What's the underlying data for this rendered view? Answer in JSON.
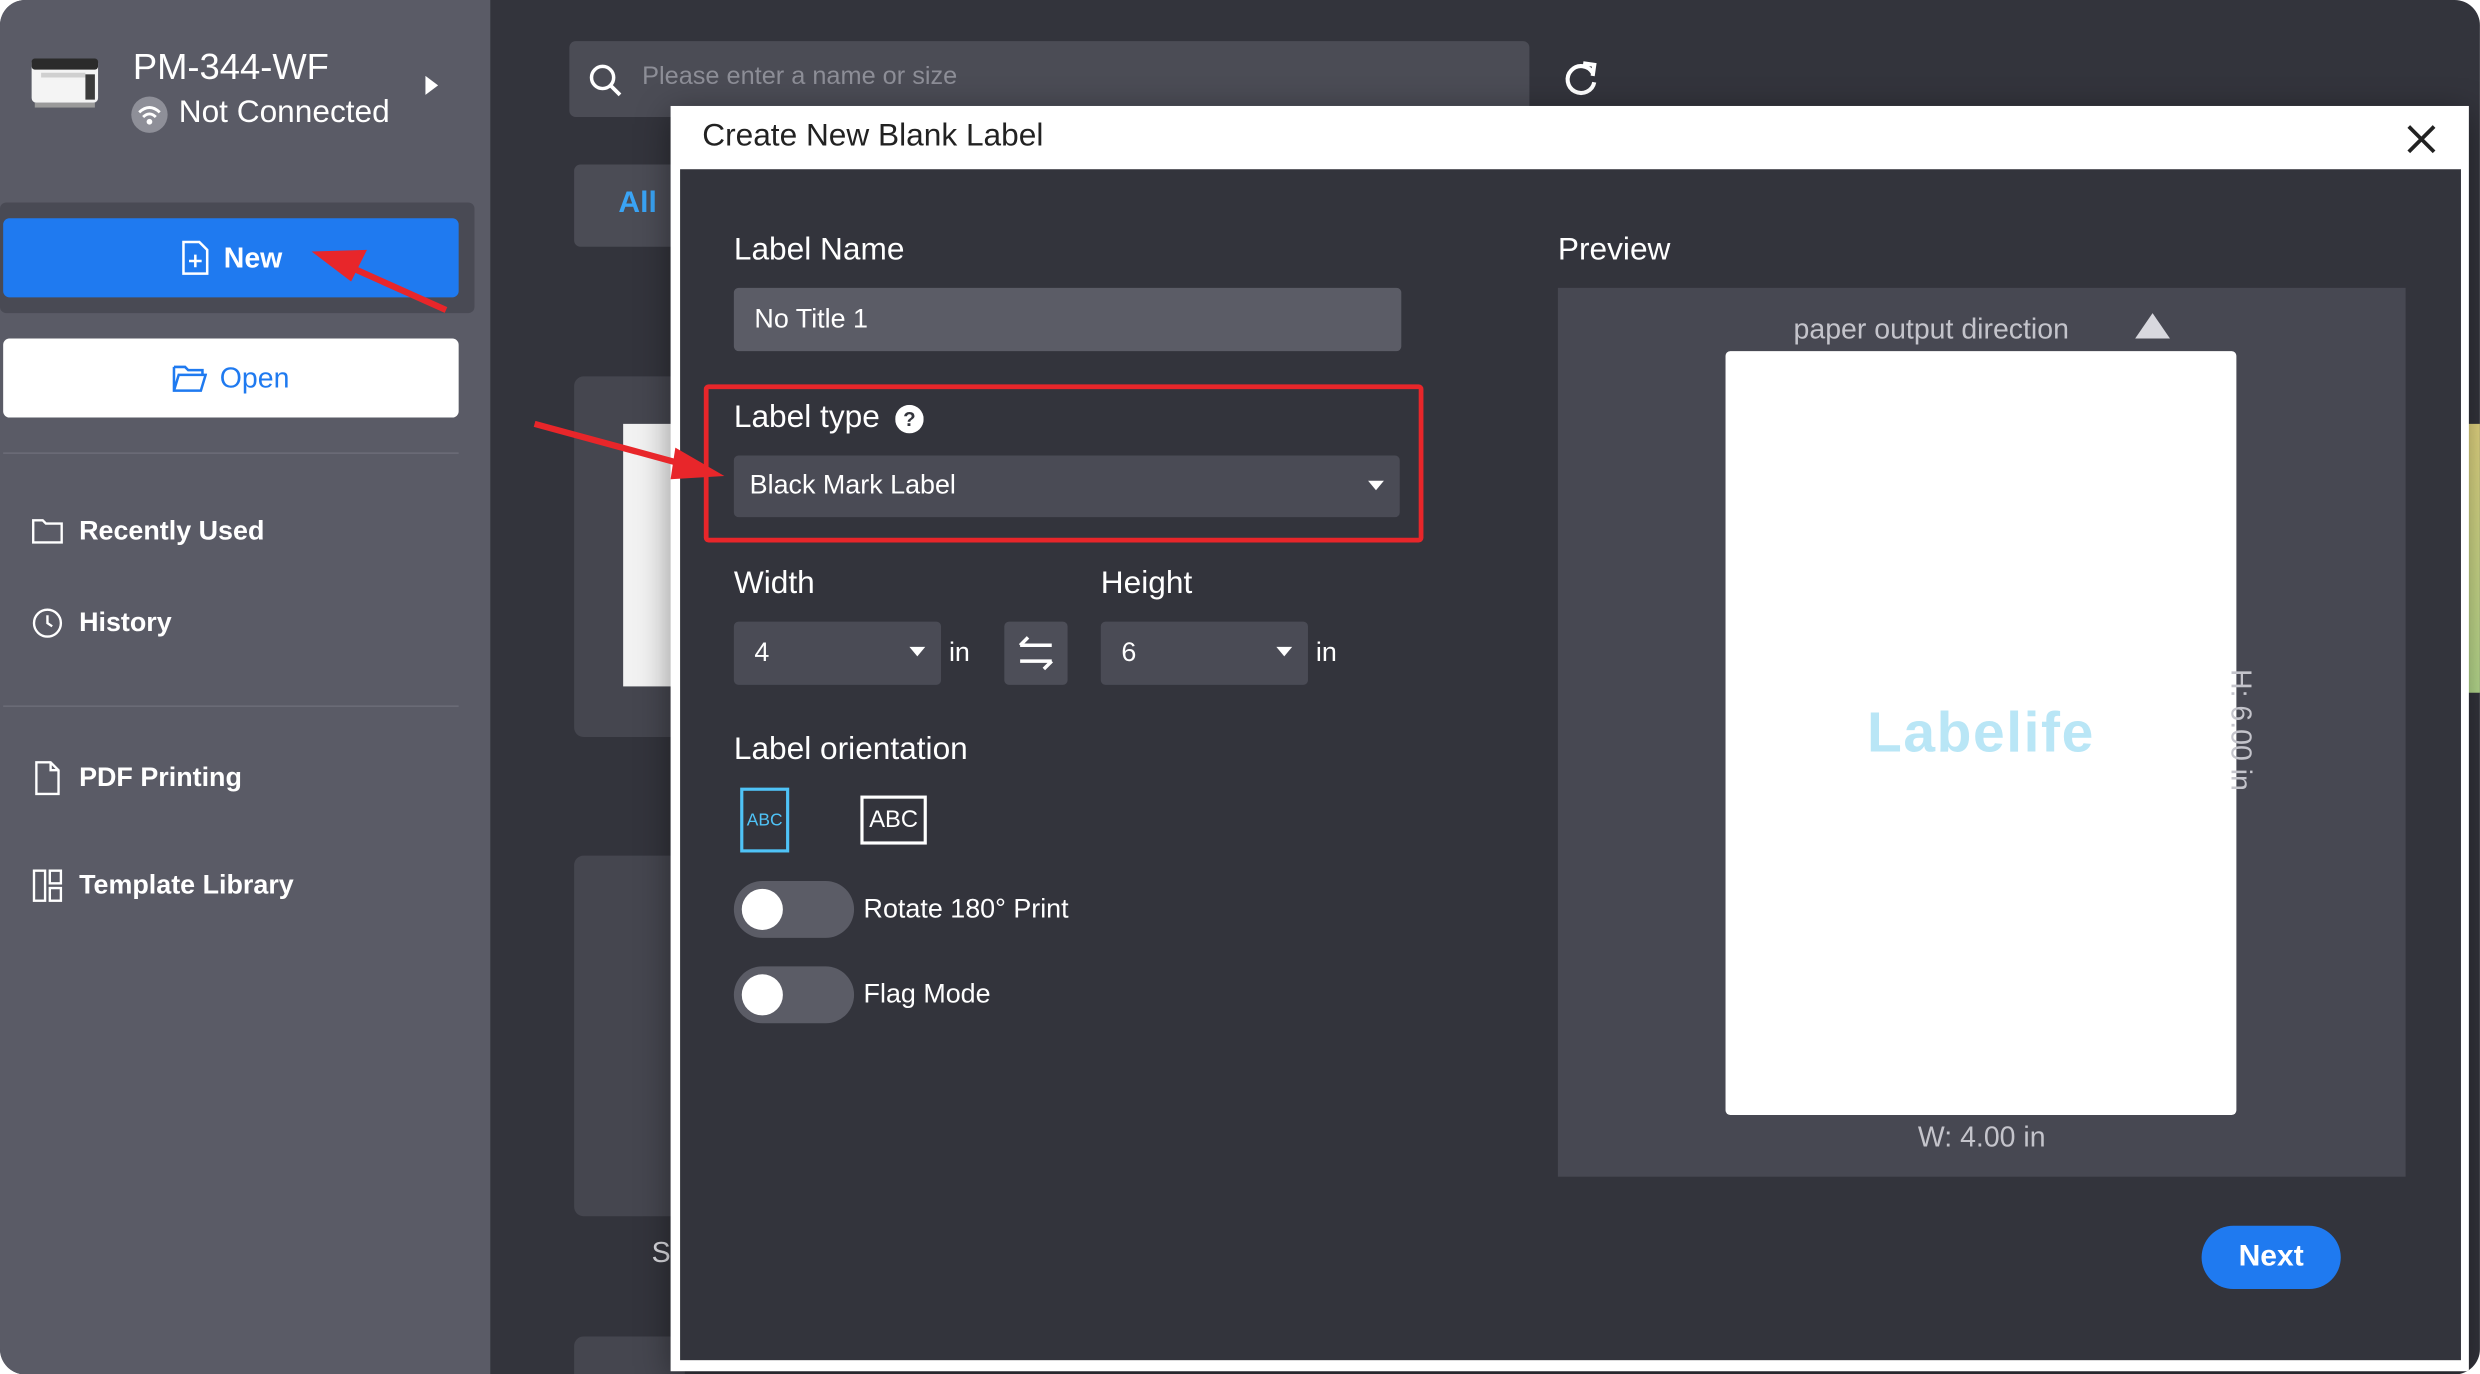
{
  "window": {
    "device_name": "PM-344-WF",
    "connection_status": "Not Connected"
  },
  "sidebar": {
    "new_label": "New",
    "open_label": "Open",
    "items": [
      {
        "label": "Recently Used",
        "icon": "folder-icon"
      },
      {
        "label": "History",
        "icon": "clock-icon"
      },
      {
        "label": "PDF Printing",
        "icon": "document-icon"
      },
      {
        "label": "Template Library",
        "icon": "template-icon"
      }
    ]
  },
  "main": {
    "search_placeholder": "Please enter a name or size",
    "tab_all": "All",
    "card_caption_partial": "S"
  },
  "dialog": {
    "title": "Create New Blank Label",
    "label_name_heading": "Label Name",
    "label_name_value": "No Title 1",
    "label_type_heading": "Label type",
    "label_type_value": "Black Mark Label",
    "width_heading": "Width",
    "width_value": "4",
    "height_heading": "Height",
    "height_value": "6",
    "unit": "in",
    "orientation_heading": "Label orientation",
    "orientation_options": [
      "ABC",
      "ABC"
    ],
    "orientation_selected": 0,
    "rotate_label": "Rotate 180° Print",
    "rotate_on": false,
    "flag_label": "Flag Mode",
    "flag_on": false,
    "preview_heading": "Preview",
    "paper_direction": "paper output direction",
    "preview_logo": "Labelife",
    "width_dimension": "W: 4.00 in",
    "height_dimension": "H: 6.00 in",
    "next_label": "Next"
  },
  "colors": {
    "accent_blue": "#1f7af0",
    "sidebar_bg": "#5a5b66",
    "panel_bg": "#33343c",
    "highlight_red": "#e8262a",
    "logo_color": "#b9e6f6"
  }
}
